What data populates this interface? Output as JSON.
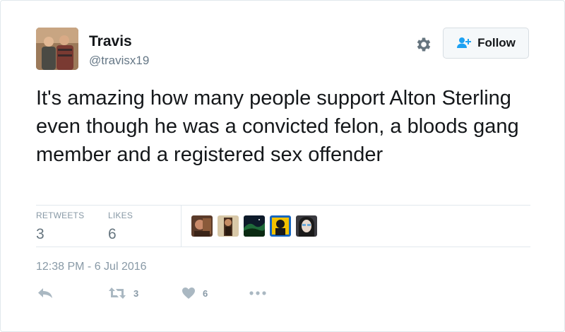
{
  "user": {
    "name": "Travis",
    "handle": "@travisx19"
  },
  "follow_button": {
    "label": "Follow",
    "icon": "add-person-icon"
  },
  "settings": {
    "icon": "gear-icon"
  },
  "tweet": {
    "text": "It's amazing how many people support Alton Sterling even though he was a convicted felon, a bloods gang member and a registered sex offender"
  },
  "stats": {
    "retweets_label": "RETWEETS",
    "retweets_value": "3",
    "likes_label": "LIKES",
    "likes_value": "6"
  },
  "timestamp": "12:38 PM - 6 Jul 2016",
  "actions": {
    "reply_icon": "reply-icon",
    "retweet_icon": "retweet-icon",
    "retweet_count": "3",
    "like_icon": "heart-icon",
    "like_count": "6",
    "more_icon": "more-dots-icon"
  },
  "colors": {
    "text": "#14171a",
    "secondary": "#657786",
    "muted": "#8899a6",
    "border": "#e1e8ed",
    "button_bg": "#f5f8fa",
    "accent": "#1da1f2"
  }
}
